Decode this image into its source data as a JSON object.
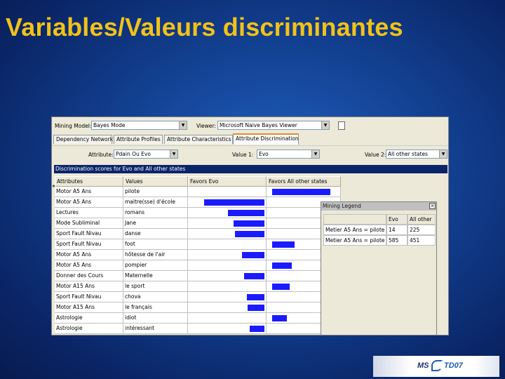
{
  "slide": {
    "title": "Variables/Valeurs discriminantes"
  },
  "toolbar": {
    "mining_model_label": "Mining Model:",
    "mining_model_value": "Bayes Mode",
    "viewer_label": "Viewer:",
    "viewer_value": "Microsoft Naive Bayes Viewer"
  },
  "tabs": [
    {
      "label": "Dependency Network"
    },
    {
      "label": "Attribute Profiles"
    },
    {
      "label": "Attribute Characteristics"
    },
    {
      "label": "Attribute Discrimination",
      "active": true
    }
  ],
  "filters": {
    "attribute_label": "Attribute:",
    "attribute_value": "Pdain Ou Evo",
    "value1_label": "Value 1:",
    "value1_value": "Evo",
    "value2_label": "Value 2:",
    "value2_value": "All other states"
  },
  "discrimination": {
    "header": "Discrimination scores for Evo and All other states",
    "columns": [
      "Attributes",
      "Values",
      "Favors Evo",
      "Favors All other states"
    ],
    "rows": [
      {
        "attribute": "Motor A5 Ans",
        "value": "pilote",
        "favors_evo": 0,
        "favors_other": 0.8
      },
      {
        "attribute": "Motor A5 Ans",
        "value": "maitre(sse) d'école",
        "favors_evo": 0.78,
        "favors_other": 0
      },
      {
        "attribute": "Lectures",
        "value": "romans",
        "favors_evo": 0.47,
        "favors_other": 0
      },
      {
        "attribute": "Mode Subliminal",
        "value": "Jane",
        "favors_evo": 0.4,
        "favors_other": 0
      },
      {
        "attribute": "Sport Fault Nivau",
        "value": "danse",
        "favors_evo": 0.38,
        "favors_other": 0
      },
      {
        "attribute": "Sport Fault Nivau",
        "value": "foot",
        "favors_evo": 0,
        "favors_other": 0.31
      },
      {
        "attribute": "Motor A5 Ans",
        "value": "hôtesse de l'air",
        "favors_evo": 0.29,
        "favors_other": 0
      },
      {
        "attribute": "Motor A5 Ans",
        "value": "pompier",
        "favors_evo": 0,
        "favors_other": 0.27
      },
      {
        "attribute": "Donner des Cours",
        "value": "Maternelle",
        "favors_evo": 0.26,
        "favors_other": 0
      },
      {
        "attribute": "Motor A15 Ans",
        "value": "le sport",
        "favors_evo": 0,
        "favors_other": 0.24
      },
      {
        "attribute": "Sport Fault Nivau",
        "value": "chova",
        "favors_evo": 0.23,
        "favors_other": 0
      },
      {
        "attribute": "Motor A15 Ans",
        "value": "le français",
        "favors_evo": 0.22,
        "favors_other": 0
      },
      {
        "attribute": "Astrologie",
        "value": "idiot",
        "favors_evo": 0,
        "favors_other": 0.2
      },
      {
        "attribute": "Astrologie",
        "value": "intéressant",
        "favors_evo": 0.19,
        "favors_other": 0
      }
    ],
    "bar_color": "#1b1bff"
  },
  "legend": {
    "title": "Mining Legend",
    "columns": [
      "",
      "Evo",
      "All other"
    ],
    "rows": [
      {
        "label": "Metier A5 Ans = pilote",
        "evo": "14",
        "other": "225"
      },
      {
        "label": "Metier A5 Ans = pilote",
        "evo": "585",
        "other": "451"
      }
    ]
  },
  "logo": {
    "ms": "MS",
    "td": "TD07"
  },
  "colors": {
    "title": "#f2c218",
    "header_band": "#0a246a",
    "active_tab_accent": "#e68b2c"
  }
}
